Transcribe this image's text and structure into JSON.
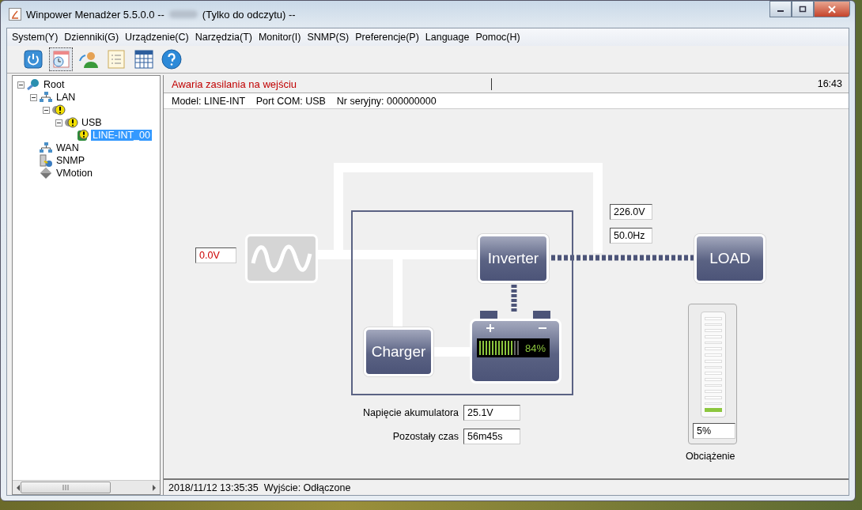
{
  "window": {
    "title_prefix": "Winpower Menadżer 5.5.0.0 --",
    "title_suffix": "(Tylko do odczytu) --"
  },
  "menu": [
    "System(Y)",
    "Dzienniki(G)",
    "Urządzenie(C)",
    "Narzędzia(T)",
    "Monitor(I)",
    "SNMP(S)",
    "Preferencje(P)",
    "Language",
    "Pomoc(H)"
  ],
  "toolbar": [
    {
      "kind": "power",
      "selected": false
    },
    {
      "kind": "calendar",
      "selected": true
    },
    {
      "kind": "user",
      "selected": false
    },
    {
      "kind": "list",
      "selected": false
    },
    {
      "kind": "grid",
      "selected": false
    },
    {
      "kind": "help",
      "selected": false
    }
  ],
  "tree": [
    {
      "label": "Root",
      "kind": "globe",
      "expanded": true,
      "selected": false,
      "children": [
        {
          "label": "LAN",
          "kind": "network",
          "expanded": true,
          "selected": false,
          "children": [
            {
              "kind": "warning",
              "expanded": true,
              "selected": false,
              "children": [
                {
                  "label": "USB",
                  "kind": "warning",
                  "expanded": true,
                  "selected": false,
                  "children": [
                    {
                      "label": "LINE-INT_00",
                      "kind": "ups",
                      "selected": true
                    }
                  ]
                }
              ]
            }
          ]
        },
        {
          "label": "WAN",
          "kind": "network",
          "selected": false
        },
        {
          "label": "SNMP",
          "kind": "snmp",
          "selected": false
        },
        {
          "label": "VMotion",
          "kind": "vmotion",
          "selected": false
        }
      ]
    }
  ],
  "alarm": {
    "message": "Awaria zasilania na wejściu",
    "time": "16:43"
  },
  "device_info": "Model: LINE-INT    Port COM: USB    Nr seryjny: 000000000",
  "diagram": {
    "input_voltage": "0.0V",
    "inverter": "Inverter",
    "charger": "Charger",
    "battery": {
      "level": 0.84,
      "reading": "84%"
    },
    "output_voltage": "226.0V",
    "output_frequency": "50.0Hz",
    "load": "LOAD",
    "load_meter": {
      "level": 0.05,
      "reading": "5%",
      "label": "Obciążenie"
    },
    "battery_stats": [
      {
        "label": "Napięcie akumulatora",
        "value": "25.1V"
      },
      {
        "label": "Pozostały czas",
        "value": "56m45s"
      }
    ]
  },
  "status_bar": "2018/11/12 13:35:35  Wyjście: Odłączone"
}
